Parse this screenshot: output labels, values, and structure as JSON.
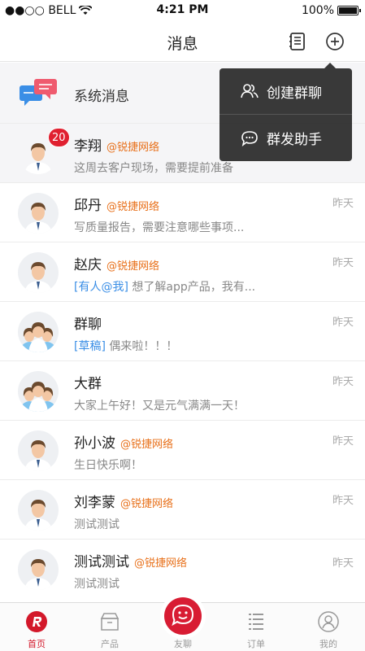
{
  "status_bar": {
    "carrier": "●●○○ BELL",
    "time": "4:21 PM",
    "battery": "100%"
  },
  "nav": {
    "title": "消息"
  },
  "dropdown": {
    "items": [
      {
        "label": "创建群聊"
      },
      {
        "label": "群发助手"
      }
    ]
  },
  "conversations": [
    {
      "name": "系统消息"
    },
    {
      "name": "李翔",
      "org": "@锐捷网络",
      "preview": "这周去客户现场，需要提前准备",
      "badge": "20"
    },
    {
      "name": "邱丹",
      "org": "@锐捷网络",
      "preview": "写质量报告，需要注意哪些事项...",
      "time": "昨天"
    },
    {
      "name": "赵庆",
      "org": "@锐捷网络",
      "tag": "[有人@我]",
      "preview": " 想了解app产品，我有...",
      "time": "昨天"
    },
    {
      "name": "群聊",
      "tag": "[草稿]",
      "preview": " 偶来啦！！！",
      "time": "昨天"
    },
    {
      "name": "大群",
      "preview": "大家上午好！又是元气满满一天！",
      "time": "昨天"
    },
    {
      "name": "孙小波",
      "org": "@锐捷网络",
      "preview": "生日快乐啊！",
      "time": "昨天"
    },
    {
      "name": "刘李蒙",
      "org": "@锐捷网络",
      "preview": "测试测试",
      "time": "昨天"
    },
    {
      "name": "测试测试",
      "org": "@锐捷网络",
      "preview": "测试测试",
      "time": "昨天"
    }
  ],
  "tabs": [
    {
      "label": "首页",
      "icon": "home-logo-icon"
    },
    {
      "label": "产品",
      "icon": "box-icon"
    },
    {
      "label": "友聊",
      "icon": "chat-face-icon"
    },
    {
      "label": "订单",
      "icon": "list-icon"
    },
    {
      "label": "我的",
      "icon": "profile-icon"
    }
  ],
  "colors": {
    "accent": "#d81c33",
    "org": "#e8701a",
    "tag": "#3a8ee6"
  }
}
